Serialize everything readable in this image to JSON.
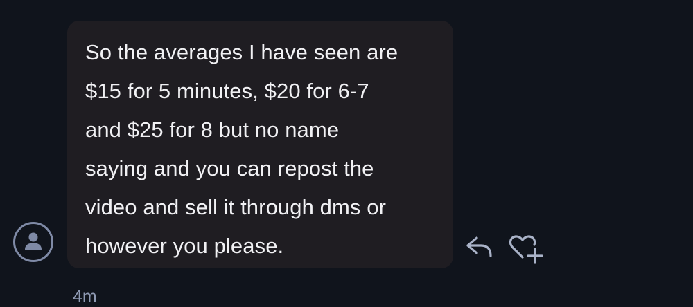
{
  "message": {
    "text": "So the averages I have seen are\n$15 for 5 minutes, $20 for 6-7\nand $25 for 8 but no name\nsaying and you can repost the\nvideo and sell it through dms or\nhowever you please.",
    "timestamp": "4m"
  },
  "icons": {
    "avatar": "user-avatar-icon",
    "reply": "reply-arrow-icon",
    "react": "heart-plus-icon"
  },
  "colors": {
    "background": "#10141c",
    "bubble": "#1f1d22",
    "text": "#f1f1f4",
    "icon": "#aab3c8",
    "timestamp": "#8f9ab3"
  }
}
